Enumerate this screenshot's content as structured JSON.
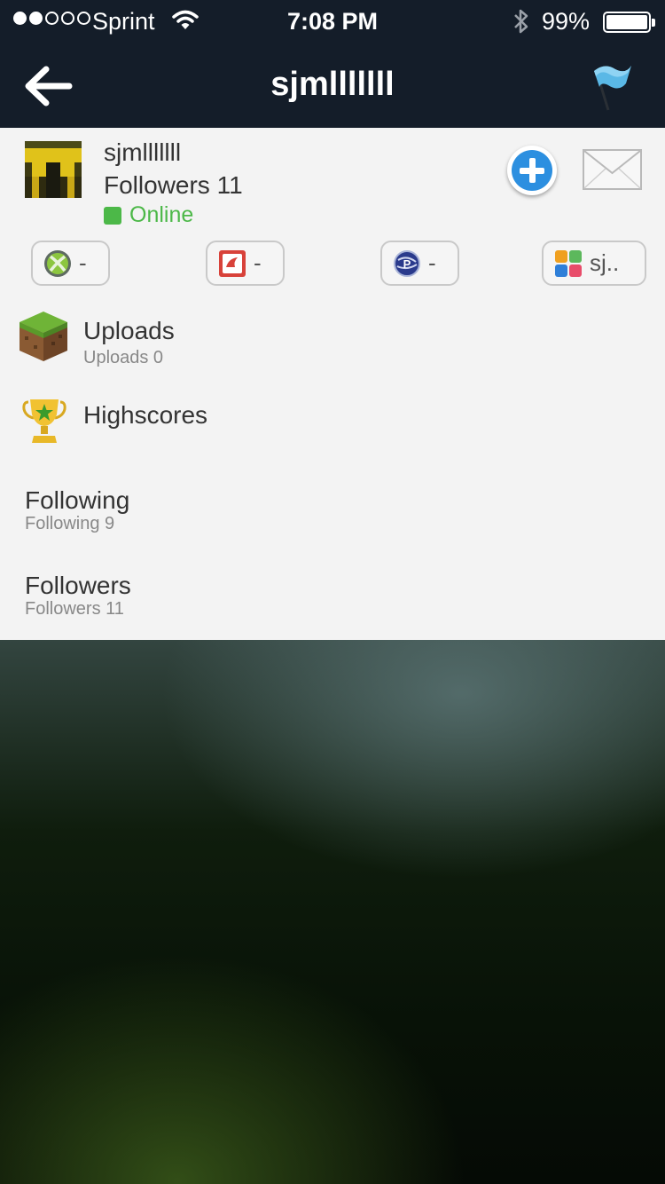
{
  "status_bar": {
    "carrier": "Sprint",
    "time": "7:08 PM",
    "battery": "99%",
    "signal_bars_filled": 2,
    "signal_bars_total": 5
  },
  "nav": {
    "title": "sjmlllllll",
    "back_icon": "arrow-left-icon",
    "flag_icon": "flag-icon"
  },
  "profile": {
    "username": "sjmlllllll",
    "followers_text": "Followers 11",
    "status": "Online",
    "status_color": "#4cb848"
  },
  "gamer_tags": [
    {
      "icon": "xbox-icon",
      "label": "-"
    },
    {
      "icon": "game-center-icon",
      "label": "-"
    },
    {
      "icon": "playstation-network-icon",
      "label": "-"
    },
    {
      "icon": "multi-app-icon",
      "label": "sj.."
    }
  ],
  "menu": {
    "uploads": {
      "title": "Uploads",
      "subtitle": "Uploads 0"
    },
    "highscores": {
      "title": "Highscores"
    },
    "following": {
      "title": "Following",
      "subtitle": "Following 9"
    },
    "followers": {
      "title": "Followers",
      "subtitle": "Followers 11"
    }
  },
  "colors": {
    "nav_bg": "#141d29",
    "panel_bg": "#f3f3f3",
    "accent_blue": "#2c8fe0"
  }
}
